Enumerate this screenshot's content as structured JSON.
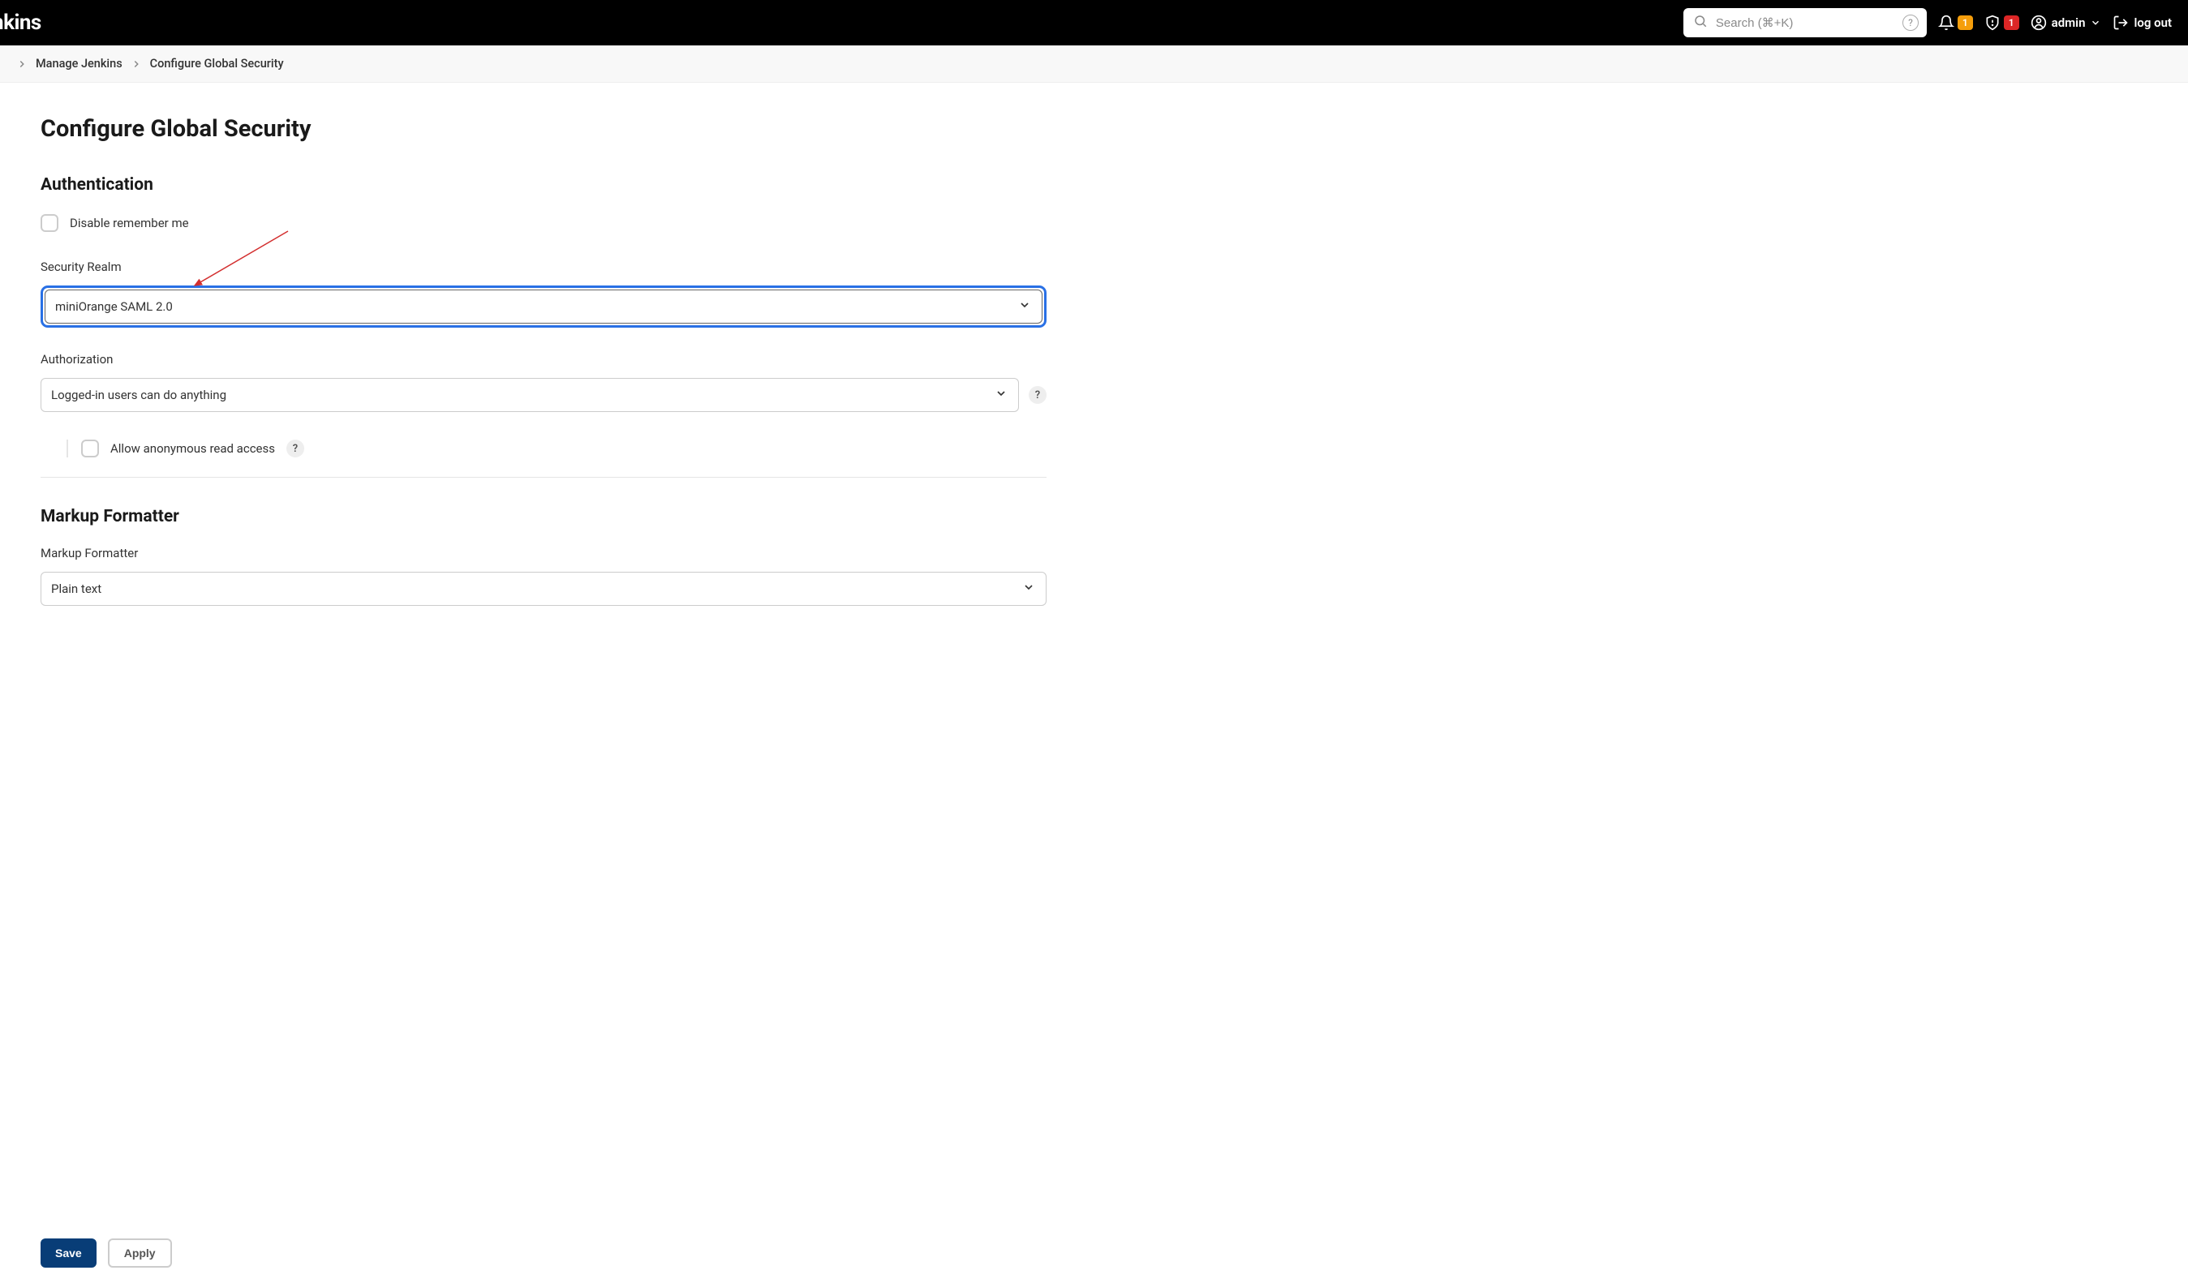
{
  "header": {
    "logo_text": "nkins",
    "search_placeholder": "Search (⌘+K)",
    "notification_count": "1",
    "security_alert_count": "1",
    "username": "admin",
    "logout_label": "log out"
  },
  "breadcrumb": {
    "items": [
      "Manage Jenkins",
      "Configure Global Security"
    ]
  },
  "page": {
    "title": "Configure Global Security"
  },
  "authentication": {
    "section_title": "Authentication",
    "disable_remember_label": "Disable remember me",
    "security_realm_label": "Security Realm",
    "security_realm_value": "miniOrange SAML 2.0",
    "authorization_label": "Authorization",
    "authorization_value": "Logged-in users can do anything",
    "allow_anonymous_label": "Allow anonymous read access"
  },
  "markup_formatter": {
    "section_title": "Markup Formatter",
    "field_label": "Markup Formatter",
    "value": "Plain text"
  },
  "buttons": {
    "save": "Save",
    "apply": "Apply"
  },
  "help_symbol": "?"
}
